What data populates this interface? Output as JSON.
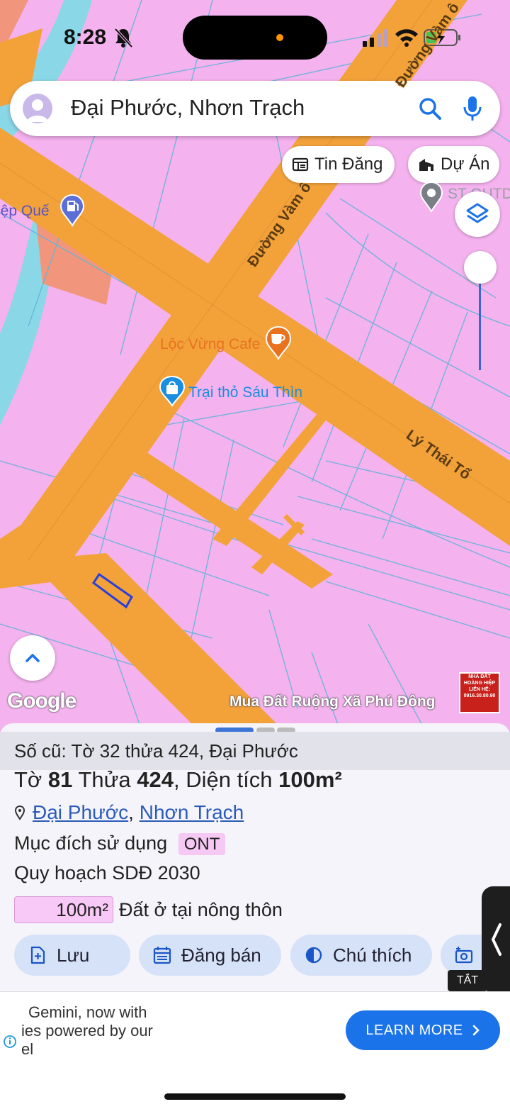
{
  "status_bar": {
    "time": "8:28"
  },
  "search": {
    "query": "Đại Phước, Nhơn Trạch"
  },
  "chips": {
    "tin_dang": "Tin Đăng",
    "du_an": "Dự Án"
  },
  "map_labels": {
    "road_vam_o": "Đường Vàm ô",
    "road_vam_o_top": "Đường Vàm ô",
    "road_ly_thai_to": "Lý Thái Tổ",
    "poi_cafe": "Lộc Vừng Cafe",
    "poi_trai_tho": "Trại thỏ Sáu Thìn",
    "poi_left": "iệp Quế",
    "poi_right": "ST OUTD"
  },
  "map_footer": {
    "google": "Google",
    "ad_text": "Mua Đất Ruộng Xã Phú Đông",
    "ad_image_text": "NHÀ ĐẤT HOÀNG HIỆP LIÊN HỆ: 0916.30.80.90"
  },
  "parcel": {
    "old_ref": "Số cũ: Tờ 32 thửa 424, Đại Phước",
    "title_to_label": "Tờ",
    "title_to": "81",
    "title_thua_label": "Thửa",
    "title_thua": "424",
    "title_area_label": ", Diện tích",
    "title_area": "100m²",
    "location_ward": "Đại Phước",
    "location_sep": ",",
    "location_district": "Nhơn Trạch",
    "purpose_label": "Mục đích sử dụng",
    "purpose_code": "ONT",
    "planning": "Quy hoạch SDĐ 2030",
    "planning_area": "100m²",
    "planning_type": "Đất ở tại nông thôn"
  },
  "actions": {
    "save": "Lưu",
    "post_sale": "Đăng bán",
    "legend": "Chú thích",
    "camera_badge": "TẮT"
  },
  "ad": {
    "line1": "Gemini, now with",
    "line2": "ies powered by our",
    "line3": "el",
    "cta": "LEARN MORE"
  },
  "colors": {
    "residential": "#f4b2ee",
    "road": "#f3a23a",
    "parcel_line": "#5fb4d8",
    "accent_blue": "#1a73e8",
    "poi_orange": "#e8721e"
  }
}
